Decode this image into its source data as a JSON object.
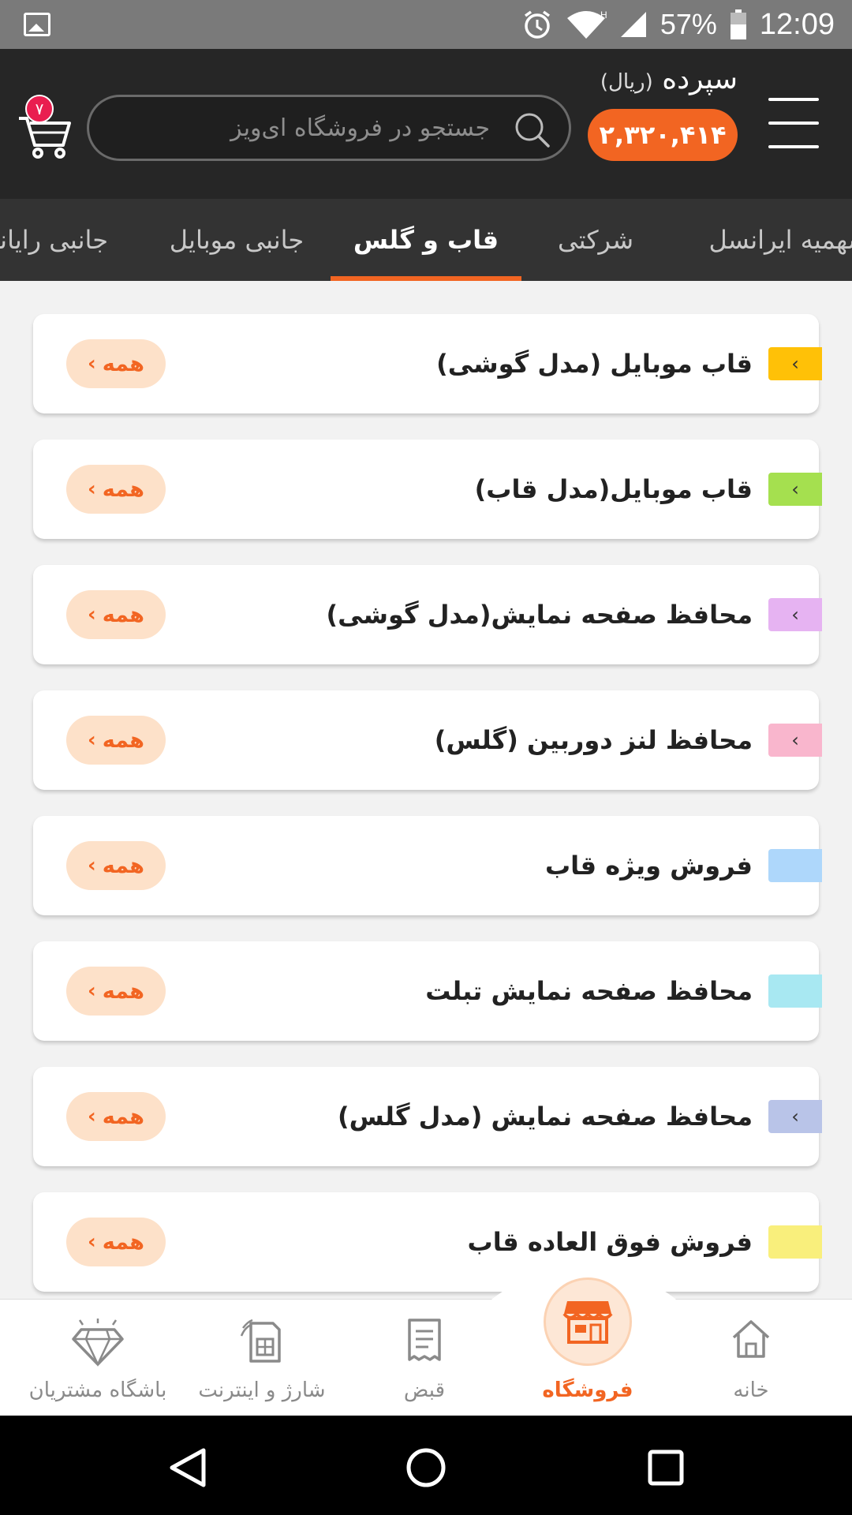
{
  "status_bar": {
    "battery_percent": "57%",
    "time": "12:09",
    "network_type": "H",
    "icons": [
      "gallery-icon",
      "alarm-icon",
      "wifi-icon",
      "signal-icon",
      "battery-icon"
    ]
  },
  "header": {
    "balance_label": "سپرده",
    "balance_unit": "(ریال)",
    "balance_value": "۲,۳۲۰,۴۱۴",
    "search_placeholder": "جستجو در فروشگاه ای‌ویز",
    "cart_count": "۷"
  },
  "tabs": [
    {
      "label": "سهمیه ایرانسل"
    },
    {
      "label": "شرکتی"
    },
    {
      "label": "قاب و گلس"
    },
    {
      "label": "جانبی موبایل"
    },
    {
      "label": "جانبی رایانه"
    }
  ],
  "active_tab": "قاب و گلس",
  "categories": [
    {
      "title": "قاب موبایل (مدل گوشی)",
      "color": "#ffc107",
      "has_arrow": true,
      "all_label": "همه"
    },
    {
      "title": "قاب موبایل(مدل قاب)",
      "color": "#a5e04f",
      "has_arrow": true,
      "all_label": "همه"
    },
    {
      "title": "محافظ صفحه نمایش(مدل گوشی)",
      "color": "#e6b3f2",
      "has_arrow": true,
      "all_label": "همه"
    },
    {
      "title": "محافظ لنز دوربین (گلس)",
      "color": "#f9b6cd",
      "has_arrow": true,
      "all_label": "همه"
    },
    {
      "title": "فروش ویژه قاب",
      "color": "#aed7fb",
      "has_arrow": false,
      "all_label": "همه"
    },
    {
      "title": "محافظ صفحه نمایش تبلت",
      "color": "#a8e8f2",
      "has_arrow": false,
      "all_label": "همه"
    },
    {
      "title": "محافظ صفحه نمایش (مدل گلس)",
      "color": "#b9c4e8",
      "has_arrow": true,
      "all_label": "همه"
    },
    {
      "title": "فروش فوق العاده قاب",
      "color": "#f9ef7c",
      "has_arrow": false,
      "all_label": "همه"
    }
  ],
  "bottom_nav": [
    {
      "label": "خانه",
      "icon": "home-icon"
    },
    {
      "label": "فروشگاه",
      "icon": "store-icon",
      "active": true
    },
    {
      "label": "قبض",
      "icon": "bill-icon"
    },
    {
      "label": "شارژ و اینترنت",
      "icon": "sim-card-icon"
    },
    {
      "label": "باشگاه مشتریان",
      "icon": "diamond-icon"
    }
  ],
  "colors": {
    "accent": "#f26522",
    "header_bg": "#262626",
    "tab_bg": "#333333",
    "badge": "#e91e50"
  }
}
